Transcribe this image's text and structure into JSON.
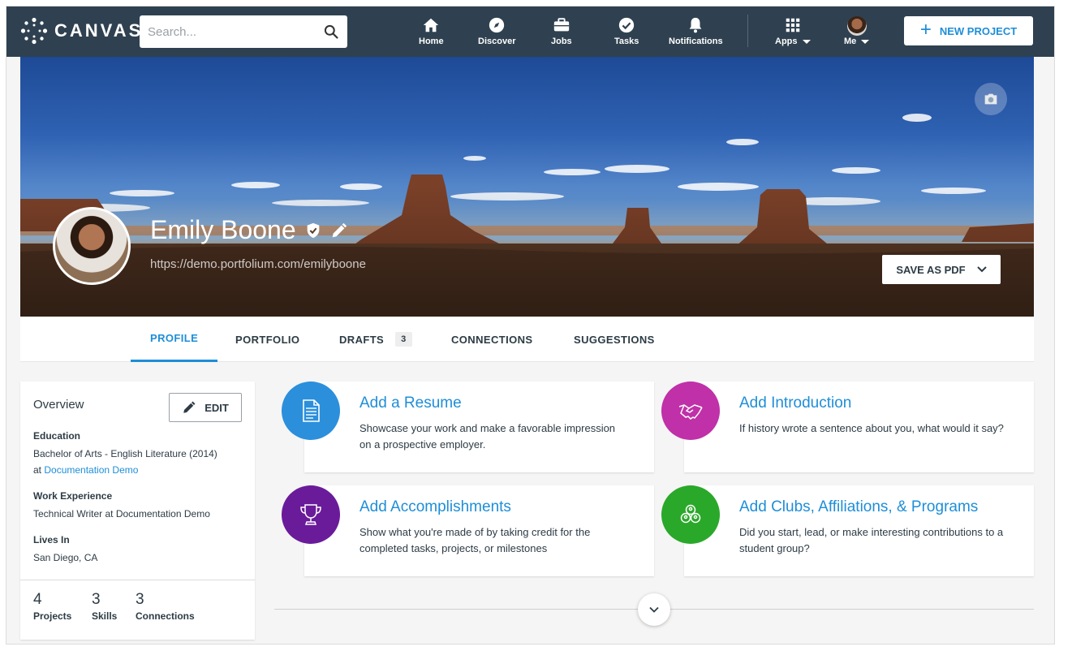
{
  "nav": {
    "brand": "CANVAS",
    "search_placeholder": "Search...",
    "items": [
      {
        "label": "Home",
        "icon": "home-icon"
      },
      {
        "label": "Discover",
        "icon": "compass-icon"
      },
      {
        "label": "Jobs",
        "icon": "briefcase-icon"
      },
      {
        "label": "Tasks",
        "icon": "check-circle-icon"
      },
      {
        "label": "Notifications",
        "icon": "bell-icon"
      },
      {
        "label": "Apps",
        "icon": "grid-icon"
      },
      {
        "label": "Me",
        "icon": "avatar"
      }
    ],
    "new_project_label": "NEW PROJECT"
  },
  "profile": {
    "name": "Emily Boone",
    "url": "https://demo.portfolium.com/emilyboone",
    "save_pdf_label": "SAVE AS PDF"
  },
  "tabs": [
    {
      "label": "PROFILE",
      "active": true
    },
    {
      "label": "PORTFOLIO"
    },
    {
      "label": "DRAFTS",
      "badge": "3"
    },
    {
      "label": "CONNECTIONS"
    },
    {
      "label": "SUGGESTIONS"
    }
  ],
  "overview": {
    "title": "Overview",
    "edit_label": "EDIT",
    "education_label": "Education",
    "education_text": "Bachelor of Arts - English Literature (2014)",
    "education_at": "at",
    "education_link": "Documentation Demo",
    "work_label": "Work Experience",
    "work_text": "Technical Writer at Documentation Demo",
    "lives_label": "Lives In",
    "lives_text": "San Diego, CA",
    "stats": [
      {
        "num": "4",
        "label": "Projects"
      },
      {
        "num": "3",
        "label": "Skills"
      },
      {
        "num": "3",
        "label": "Connections"
      }
    ]
  },
  "cards": [
    {
      "title": "Add a Resume",
      "desc": "Showcase your work and make a favorable impression on a prospective employer.",
      "color": "#2b8fdc",
      "icon": "document-icon"
    },
    {
      "title": "Add Introduction",
      "desc": "If history wrote a sentence about you, what would it say?",
      "color": "#c030a8",
      "icon": "handshake-icon"
    },
    {
      "title": "Add Accomplishments",
      "desc": "Show what you're made of by taking credit for the completed tasks, projects, or milestones",
      "color": "#6a1b9a",
      "icon": "trophy-icon"
    },
    {
      "title": "Add Clubs, Affiliations, & Programs",
      "desc": "Did you start, lead, or make interesting contributions to a student group?",
      "color": "#2aa82a",
      "icon": "group-icon"
    }
  ],
  "colors": {
    "nav_bg": "#2f4150",
    "accent": "#1e8ed8"
  }
}
